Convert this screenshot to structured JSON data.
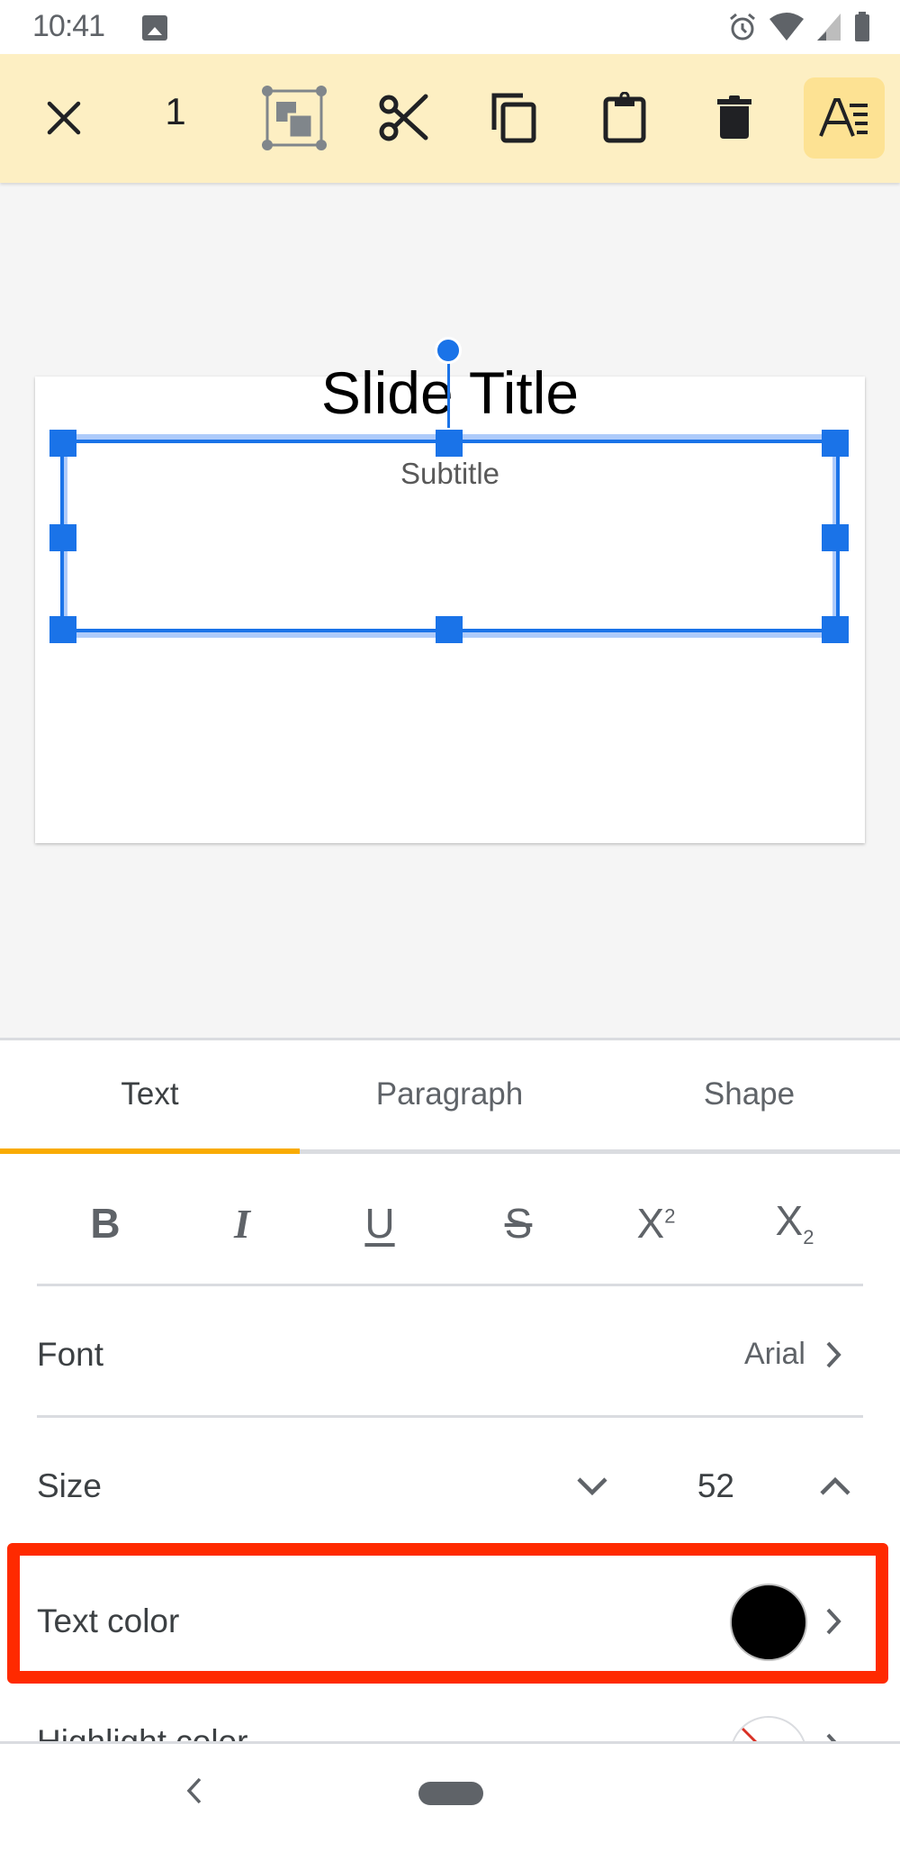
{
  "status_bar": {
    "time": "10:41",
    "left_icons": [
      "gallery-icon"
    ],
    "right_icons": [
      "alarm-icon",
      "wifi-icon",
      "signal-icon",
      "battery-icon"
    ]
  },
  "toolbar": {
    "selected_count": "1",
    "buttons": [
      {
        "name": "close",
        "icon": "close-icon"
      },
      {
        "name": "arrange",
        "icon": "arrange-icon"
      },
      {
        "name": "cut",
        "icon": "scissors-icon"
      },
      {
        "name": "copy",
        "icon": "copy-icon"
      },
      {
        "name": "paste",
        "icon": "clipboard-icon"
      },
      {
        "name": "delete",
        "icon": "trash-icon"
      },
      {
        "name": "format",
        "icon": "text-format-icon",
        "active": true
      }
    ]
  },
  "slide": {
    "title": "Slide Title",
    "subtitle": "Subtitle"
  },
  "panel": {
    "tabs": [
      {
        "label": "Text",
        "active": true
      },
      {
        "label": "Paragraph",
        "active": false
      },
      {
        "label": "Shape",
        "active": false
      }
    ],
    "format_buttons": [
      {
        "name": "bold",
        "glyph": "B",
        "icon": "bold-icon"
      },
      {
        "name": "italic",
        "glyph": "I",
        "icon": "italic-icon"
      },
      {
        "name": "underline",
        "glyph": "U",
        "icon": "underline-icon"
      },
      {
        "name": "strikethrough",
        "glyph": "S",
        "icon": "strikethrough-icon"
      },
      {
        "name": "superscript",
        "glyph": "X",
        "sup": "2",
        "icon": "superscript-icon"
      },
      {
        "name": "subscript",
        "glyph": "X",
        "sub": "2",
        "icon": "subscript-icon"
      }
    ],
    "font": {
      "label": "Font",
      "value": "Arial"
    },
    "size": {
      "label": "Size",
      "value": "52"
    },
    "text_color": {
      "label": "Text color",
      "color": "#000000"
    },
    "highlight_color": {
      "label": "Highlight color",
      "color": "none"
    }
  },
  "colors": {
    "toolbar_bg": "#FDEFC3",
    "accent_blue": "#1A73E8",
    "tab_indicator": "#F9AB00",
    "annotation_red": "#FF2A00"
  }
}
